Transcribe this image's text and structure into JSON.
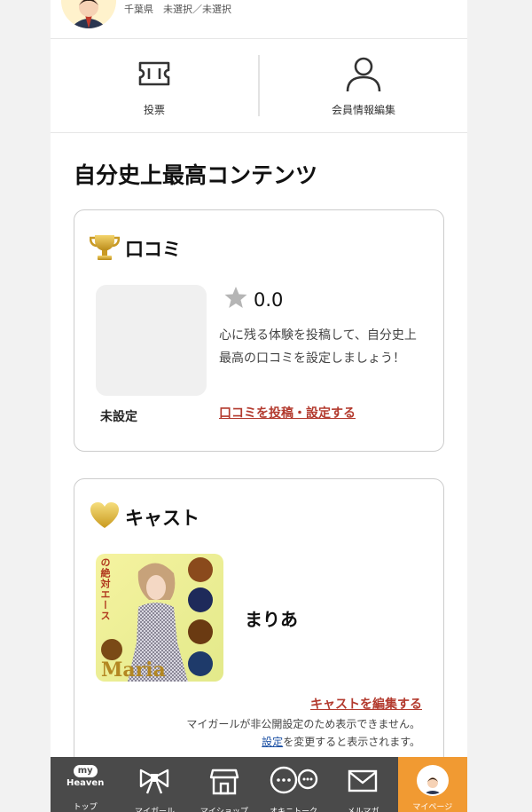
{
  "profile": {
    "location": "千葉県　未選択／未選択"
  },
  "actions": [
    {
      "label": "投票",
      "icon": "ticket-icon"
    },
    {
      "label": "会員情報編集",
      "icon": "user-icon"
    }
  ],
  "section_title": "自分史上最高コンテンツ",
  "kuchikomi": {
    "title": "口コミ",
    "icon": "trophy-icon",
    "unset_label": "未設定",
    "rating": "0.0",
    "description": "心に残る体験を投稿して、自分史上最高の口コミを設定しましょう！",
    "post_link": "口コミを投稿・設定する"
  },
  "cast": {
    "title": "キャスト",
    "icon": "heart-icon",
    "name": "まりあ",
    "photo_caption": "Maria",
    "photo_text": "の絶対エース",
    "edit_link": "キャストを編集する",
    "note_line1": "マイガールが非公開設定のため表示できません。",
    "note_link": "設定",
    "note_line2_rest": "を変更すると表示されます。"
  },
  "tabbar": {
    "tabs": [
      {
        "label": "トップ",
        "icon": "my-heaven-logo-icon"
      },
      {
        "label": "マイガール",
        "icon": "ribbon-icon"
      },
      {
        "label": "マイショップ",
        "icon": "shop-icon"
      },
      {
        "label": "オキニトーク",
        "icon": "chat-bubbles-icon"
      },
      {
        "label": "メルマガ",
        "icon": "mail-icon"
      },
      {
        "label": "マイページ",
        "icon": "avatar-icon"
      }
    ],
    "logo_top": "my",
    "logo_bottom": "Heaven"
  },
  "colors": {
    "accent_red": "#b33a2e",
    "link_blue": "#1a4fa3",
    "tab_active": "#f19a32",
    "tabbar_bg": "#4a4a4a"
  }
}
